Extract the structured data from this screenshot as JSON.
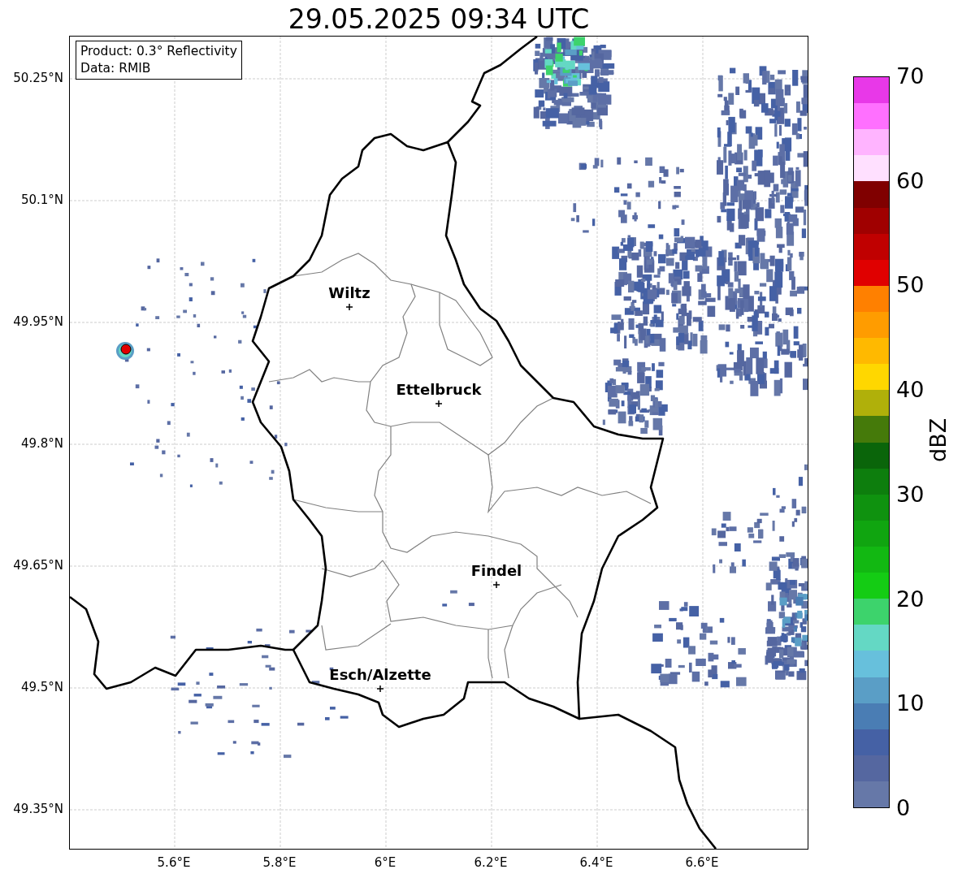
{
  "title": "29.05.2025 09:34 UTC",
  "info_box": [
    "Product: 0.3° Reflectivity",
    "Data: RMIB"
  ],
  "y_ticks": [
    "50.25°N",
    "50.1°N",
    "49.95°N",
    "49.8°N",
    "49.65°N",
    "49.5°N",
    "49.35°N"
  ],
  "x_ticks": [
    "5.6°E",
    "5.8°E",
    "6°E",
    "6.2°E",
    "6.4°E",
    "6.6°E"
  ],
  "cities": [
    {
      "name": "Wiltz"
    },
    {
      "name": "Ettelbruck"
    },
    {
      "name": "Findel"
    },
    {
      "name": "Esch/Alzette"
    }
  ],
  "colorbar": {
    "label": "dBZ",
    "ticks": [
      "70",
      "60",
      "50",
      "40",
      "30",
      "20",
      "10",
      "0"
    ],
    "segments": [
      {
        "color": "#6678a8"
      },
      {
        "color": "#5567a0"
      },
      {
        "color": "#4561a5"
      },
      {
        "color": "#4a7db4"
      },
      {
        "color": "#5a9ec6"
      },
      {
        "color": "#67c0dc"
      },
      {
        "color": "#64d8c4"
      },
      {
        "color": "#3dd36c"
      },
      {
        "color": "#14cc14"
      },
      {
        "color": "#12b812"
      },
      {
        "color": "#10a510"
      },
      {
        "color": "#0f920f"
      },
      {
        "color": "#0d7e0d"
      },
      {
        "color": "#0a650a"
      },
      {
        "color": "#457a0a"
      },
      {
        "color": "#b0b00a"
      },
      {
        "color": "#ffd700"
      },
      {
        "color": "#ffb900"
      },
      {
        "color": "#ff9c00"
      },
      {
        "color": "#ff8000"
      },
      {
        "color": "#e00000"
      },
      {
        "color": "#c00000"
      },
      {
        "color": "#a00000"
      },
      {
        "color": "#800000"
      },
      {
        "color": "#ffe0ff"
      },
      {
        "color": "#ffb4ff"
      },
      {
        "color": "#ff70ff"
      },
      {
        "color": "#e838e8"
      }
    ]
  }
}
